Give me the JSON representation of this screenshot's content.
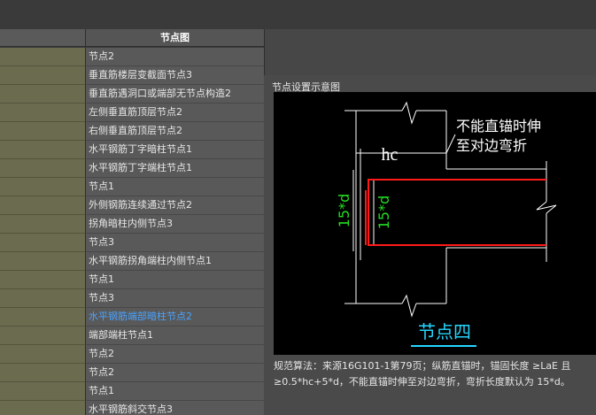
{
  "table": {
    "header": "节点图",
    "rows": [
      "节点2",
      "垂直筋楼层变截面节点3",
      "垂直筋遇洞口或端部无节点构造2",
      "左侧垂直筋顶层节点2",
      "右侧垂直筋顶层节点2",
      "水平钢筋丁字暗柱节点1",
      "水平钢筋丁字端柱节点1",
      "节点1",
      "外侧钢筋连续通过节点2",
      "拐角暗柱内侧节点3",
      "节点3",
      "水平钢筋拐角端柱内侧节点1",
      "节点1",
      "节点3",
      "水平钢筋端部暗柱节点2",
      "端部端柱节点1",
      "节点2",
      "节点2",
      "节点1",
      "水平钢筋斜交节点3"
    ],
    "active_row": 14
  },
  "diagram": {
    "title": "节点设置示意图",
    "label_hc": "hc",
    "note_line1": "不能直锚时伸",
    "note_line2": "至对边弯折",
    "dim_outer": "15*d",
    "dim_inner": "15*d",
    "caption": "节点四",
    "colors": {
      "bar": "#ff1a1a",
      "dim": "#22dd22",
      "caption": "#25d6ff",
      "line": "#ffffff"
    }
  },
  "rule": {
    "text": "规范算法：来源16G101-1第79页；纵筋直锚时，锚固长度 ≥LaE 且≥0.5*hc+5*d，不能直锚时伸至对边弯折，弯折长度默认为 15*d。"
  }
}
